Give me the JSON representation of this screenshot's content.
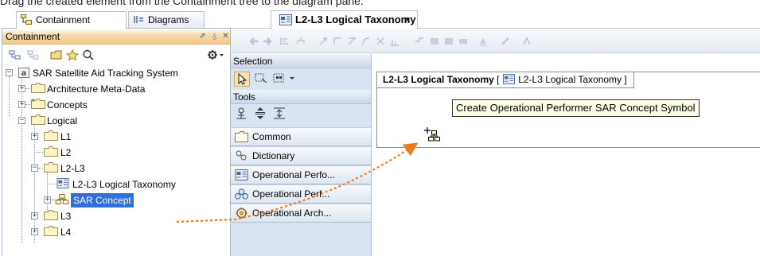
{
  "caption": "Drag the created element from the Containment tree to the diagram pane.",
  "left_panel": {
    "tabs": [
      {
        "label": "Containment",
        "icon": "containment-icon"
      },
      {
        "label": "Diagrams",
        "icon": "diagrams-icon"
      }
    ],
    "header": {
      "title": "Containment",
      "buttons": [
        "undock-icon",
        "pin-icon",
        "close-icon"
      ]
    },
    "toolbar_icons": [
      "collapse-all-icon",
      "expand-all-icon",
      "folder-new-icon",
      "favorite-icon",
      "search-icon",
      "options-icon"
    ],
    "tree": [
      {
        "label": "SAR Satellite Aid Tracking System",
        "icon": "model-icon",
        "expander": "−"
      },
      {
        "label": "Architecture Meta-Data",
        "icon": "package-icon",
        "expander": "+"
      },
      {
        "label": "Concepts",
        "icon": "package-icon",
        "expander": "+"
      },
      {
        "label": "Logical",
        "icon": "package-icon",
        "expander": "−"
      },
      {
        "label": "L1",
        "icon": "package-icon",
        "expander": "+"
      },
      {
        "label": "L2",
        "icon": "package-icon",
        "expander": ""
      },
      {
        "label": "L2-L3",
        "icon": "package-icon",
        "expander": "−"
      },
      {
        "label": "L2-L3 Logical Taxonomy",
        "icon": "diagram-icon",
        "expander": ""
      },
      {
        "label": "SAR Concept",
        "icon": "operational-performer-icon",
        "expander": "+",
        "selected": true
      },
      {
        "label": "L3",
        "icon": "package-icon",
        "expander": "+"
      },
      {
        "label": "L4",
        "icon": "package-icon",
        "expander": "+"
      }
    ]
  },
  "editor": {
    "tab": {
      "label": "L2-L3 Logical Taxonomy",
      "close": "×",
      "icon": "diagram-icon"
    },
    "palette": {
      "selection_group": "Selection",
      "tools_group": "Tools",
      "items": [
        {
          "label": "Common",
          "icon": "folder-icon"
        },
        {
          "label": "Dictionary",
          "icon": "dictionary-icon"
        },
        {
          "label": "Operational Perfo...",
          "icon": "diagram-icon"
        },
        {
          "label": "Operational Perf...",
          "icon": "operational-performer-icon"
        },
        {
          "label": "Operational Arch...",
          "icon": "operational-architecture-icon"
        }
      ]
    },
    "diagram": {
      "title": "L2-L3 Logical Taxonomy",
      "bracket_open": "[",
      "reference": "L2-L3 Logical Taxonomy",
      "bracket_close": "]",
      "tooltip": "Create Operational Performer SAR Concept Symbol"
    }
  },
  "colors": {
    "selection": "#2f6fd6",
    "drag_arrow": "#f07a1e",
    "header_orange": "#f3c987",
    "palette_bg": "#d9e4f2",
    "tooltip_bg": "#ffffe9"
  }
}
